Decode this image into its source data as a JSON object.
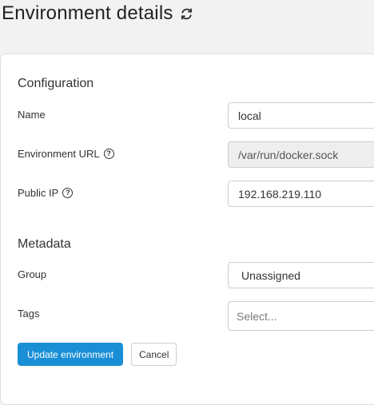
{
  "header": {
    "title": "Environment details",
    "refresh_icon": "refresh-icon"
  },
  "configuration": {
    "title": "Configuration",
    "name_label": "Name",
    "name_value": "local",
    "url_label": "Environment URL",
    "url_value": "/var/run/docker.sock",
    "public_ip_label": "Public IP",
    "public_ip_value": "192.168.219.110",
    "help_icon": "?"
  },
  "metadata": {
    "title": "Metadata",
    "group_label": "Group",
    "group_value": "Unassigned",
    "tags_label": "Tags",
    "tags_placeholder": "Select..."
  },
  "actions": {
    "update_label": "Update environment",
    "cancel_label": "Cancel"
  },
  "colors": {
    "primary": "#1a8fd6",
    "background": "#f2f2f2",
    "card": "#ffffff"
  }
}
